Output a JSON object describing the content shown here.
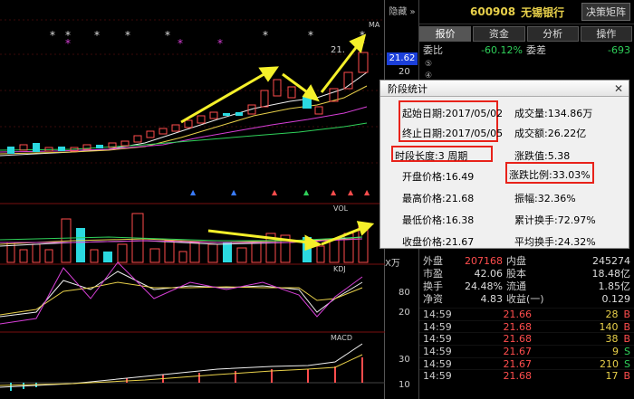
{
  "chart": {
    "hide_label": "隐藏",
    "ma_label": "MA",
    "current_price": "21.62",
    "price_axis_top": "20",
    "high_label": "21.",
    "vol_label": "VOL",
    "kdj_label": "KDJ",
    "macd_label": "MACD",
    "axis_labels": [
      "80",
      "20",
      "30",
      "10"
    ],
    "xwan": "X万"
  },
  "header": {
    "code": "600908",
    "name": "无锡银行",
    "decision_button": "决策矩阵"
  },
  "tabs": [
    {
      "label": "报价"
    },
    {
      "label": "资金"
    },
    {
      "label": "分析"
    },
    {
      "label": "操作"
    }
  ],
  "weibi": {
    "l": "委比",
    "v": "-60.12%",
    "l2": "委差",
    "v2": "-693"
  },
  "small_rows": [
    "⑤",
    "④"
  ],
  "dialog": {
    "title": "阶段统计",
    "start_date": "起始日期:2017/05/02",
    "end_date": "终止日期:2017/05/05",
    "period": "时段长度:3 周期",
    "open": "开盘价格:16.49",
    "high": "最高价格:21.68",
    "low": "最低价格:16.38",
    "close": "收盘价格:21.67",
    "volume": "成交量:134.86万",
    "amount": "成交额:26.22亿",
    "change": "涨跌值:5.38",
    "change_pct": "涨跌比例:33.03%",
    "amplitude": "振幅:32.36%",
    "turnover_total": "累计换手:72.97%",
    "turnover_avg": "平均换手:24.32%"
  },
  "outer": {
    "l": "外盘",
    "v": "207168",
    "l2": "内盘",
    "v2": "245274"
  },
  "stats": [
    {
      "l": "市盈",
      "v": "42.06",
      "l2": "股本",
      "v2": "18.48亿"
    },
    {
      "l": "换手",
      "v": "24.48%",
      "l2": "流通",
      "v2": "1.85亿"
    },
    {
      "l": "净资",
      "v": "4.83",
      "l2": "收益(一)",
      "v2": "0.129"
    }
  ],
  "trades": [
    {
      "t": "14:59",
      "p": "21.66",
      "q": "28",
      "s": "B"
    },
    {
      "t": "14:59",
      "p": "21.68",
      "q": "140",
      "s": "B"
    },
    {
      "t": "14:59",
      "p": "21.68",
      "q": "38",
      "s": "B"
    },
    {
      "t": "14:59",
      "p": "21.67",
      "q": "9",
      "s": "S"
    },
    {
      "t": "14:59",
      "p": "21.67",
      "q": "210",
      "s": "S"
    },
    {
      "t": "14:59",
      "p": "21.68",
      "q": "17",
      "s": "B"
    }
  ],
  "colors": {
    "up": "#ff4d4d",
    "down": "#2fd15a",
    "accent": "#e8d04a",
    "box": "#e8221a"
  }
}
